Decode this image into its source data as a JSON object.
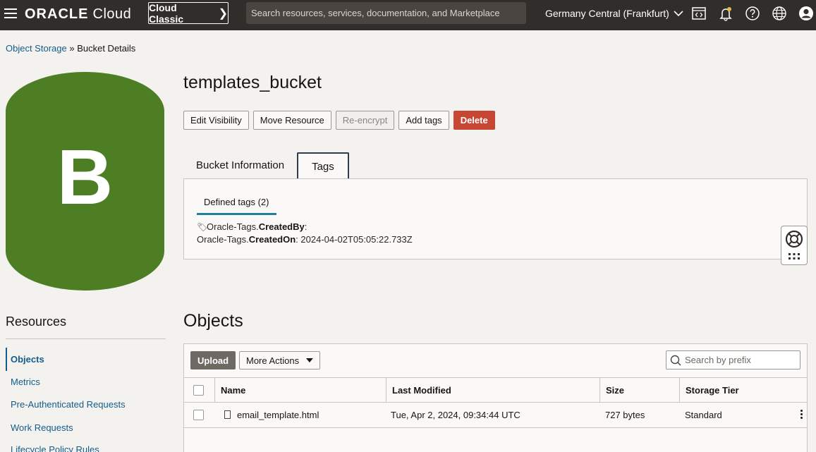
{
  "header": {
    "logo_brand": "ORACLE",
    "logo_product": "Cloud",
    "classic_label": "Cloud Classic",
    "search_placeholder": "Search resources, services, documentation, and Marketplace",
    "region": "Germany Central (Frankfurt)"
  },
  "breadcrumb": {
    "parent": "Object Storage",
    "separator": "»",
    "current": "Bucket Details"
  },
  "bucket": {
    "badge_letter": "B",
    "name": "templates_bucket",
    "badge_color": "#4e7e24"
  },
  "actions": {
    "edit_visibility": "Edit Visibility",
    "move_resource": "Move Resource",
    "re_encrypt": "Re-encrypt",
    "add_tags": "Add tags",
    "delete": "Delete"
  },
  "tabs": {
    "bucket_information": "Bucket Information",
    "tags": "Tags"
  },
  "tags_panel": {
    "subtab": "Defined tags (2)",
    "tag1_namespace": "Oracle-Tags.",
    "tag1_key": "CreatedBy",
    "tag1_sep": ":",
    "tag2_namespace": "Oracle-Tags.",
    "tag2_key": "CreatedOn",
    "tag2_sep": ":",
    "tag2_value": "2024-04-02T05:05:22.733Z"
  },
  "resources": {
    "title": "Resources",
    "items": [
      "Objects",
      "Metrics",
      "Pre-Authenticated Requests",
      "Work Requests",
      "Lifecycle Policy Rules"
    ]
  },
  "objects": {
    "title": "Objects",
    "upload": "Upload",
    "more_actions": "More Actions",
    "search_placeholder": "Search by prefix",
    "columns": [
      "Name",
      "Last Modified",
      "Size",
      "Storage Tier"
    ],
    "rows": [
      {
        "name": "email_template.html",
        "last_modified": "Tue, Apr 2, 2024, 09:34:44 UTC",
        "size": "727 bytes",
        "tier": "Standard"
      }
    ]
  },
  "colors": {
    "topbar": "#312d2a",
    "link": "#145c89",
    "danger": "#c74634"
  }
}
